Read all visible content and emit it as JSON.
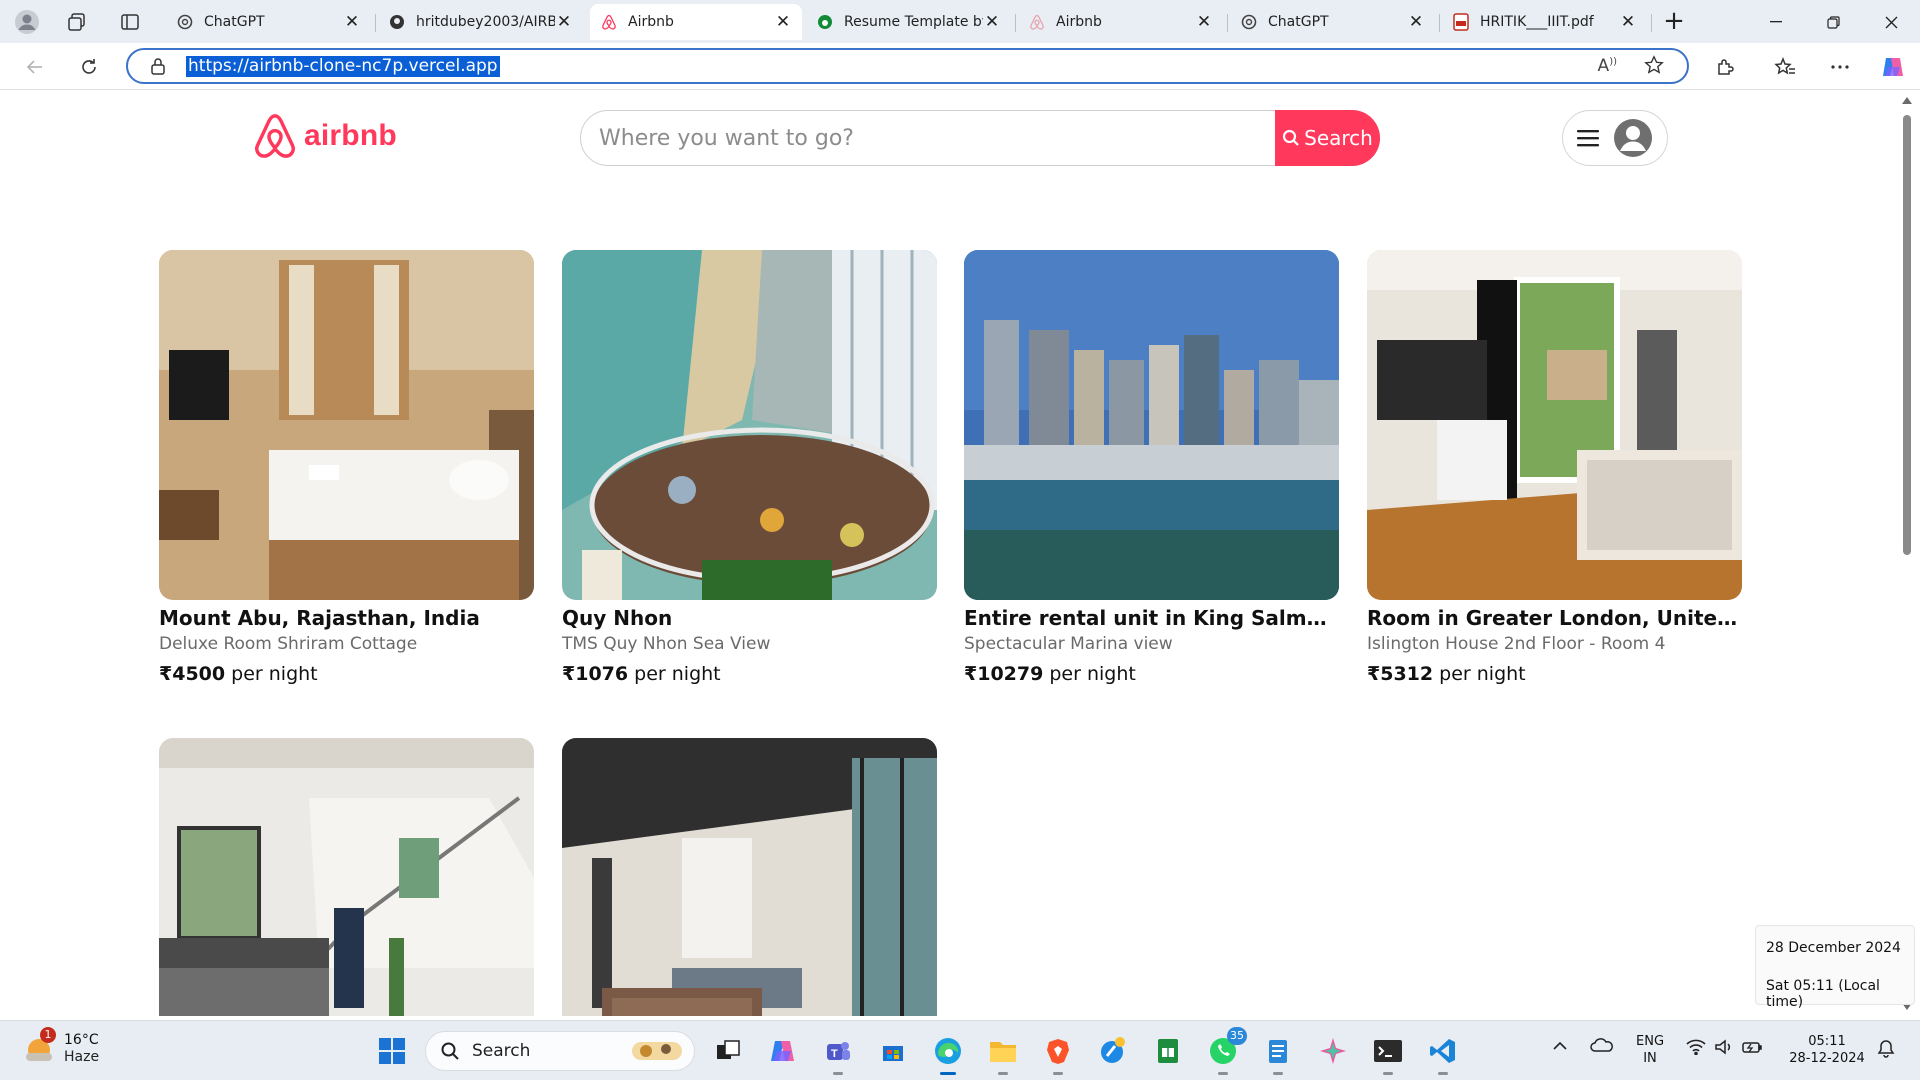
{
  "browser": {
    "tabs": [
      {
        "title": "ChatGPT",
        "icon": "chatgpt-icon",
        "active": false
      },
      {
        "title": "hritdubey2003/AIRB",
        "icon": "github-icon",
        "active": false
      },
      {
        "title": "Airbnb",
        "icon": "airbnb-icon",
        "active": true
      },
      {
        "title": "Resume Template by",
        "icon": "overleaf-icon",
        "active": false
      },
      {
        "title": "Airbnb",
        "icon": "airbnb-icon",
        "active": false
      },
      {
        "title": "ChatGPT",
        "icon": "chatgpt-icon",
        "active": false
      },
      {
        "title": "HRITIK___IIIT.pdf",
        "icon": "pdf-icon",
        "active": false
      }
    ],
    "url": "https://airbnb-clone-nc7p.vercel.app",
    "accent": "#3a73c8"
  },
  "site": {
    "brand": "airbnb",
    "brand_color": "#ff385c",
    "search_placeholder": "Where you want to go?",
    "search_button": "Search"
  },
  "listings": [
    {
      "title": "Mount Abu, Rajasthan, India",
      "subtitle": "Deluxe Room Shriram Cottage",
      "price": "₹4500",
      "per": "per night",
      "photo": "bedroom-photo"
    },
    {
      "title": "Quy Nhon",
      "subtitle": "TMS Quy Nhon Sea View",
      "price": "₹1076",
      "per": "per night",
      "photo": "sea-view-terrace-photo"
    },
    {
      "title": "Entire rental unit in King Salman Bin Abdulaziz Al Saud St",
      "subtitle": "Spectacular Marina view",
      "price": "₹10279",
      "per": "per night",
      "photo": "marina-skyline-photo"
    },
    {
      "title": "Room in Greater London, United Kingdom",
      "subtitle": "Islington House 2nd Floor - Room 4",
      "price": "₹5312",
      "per": "per night",
      "photo": "london-room-photo"
    },
    {
      "title": "",
      "subtitle": "",
      "price": "",
      "per": "",
      "photo": "staircase-kitchen-photo"
    },
    {
      "title": "",
      "subtitle": "",
      "price": "",
      "per": "",
      "photo": "living-room-photo"
    }
  ],
  "datetime_popup": {
    "date": "28 December 2024",
    "time": "Sat 05:11 (Local time)"
  },
  "taskbar": {
    "weather": {
      "temp": "16°C",
      "cond": "Haze",
      "badge": "1"
    },
    "search_label": "Search",
    "whatsapp_badge": "35",
    "lang": "ENG",
    "region": "IN",
    "clock_time": "05:11",
    "clock_date": "28-12-2024"
  }
}
